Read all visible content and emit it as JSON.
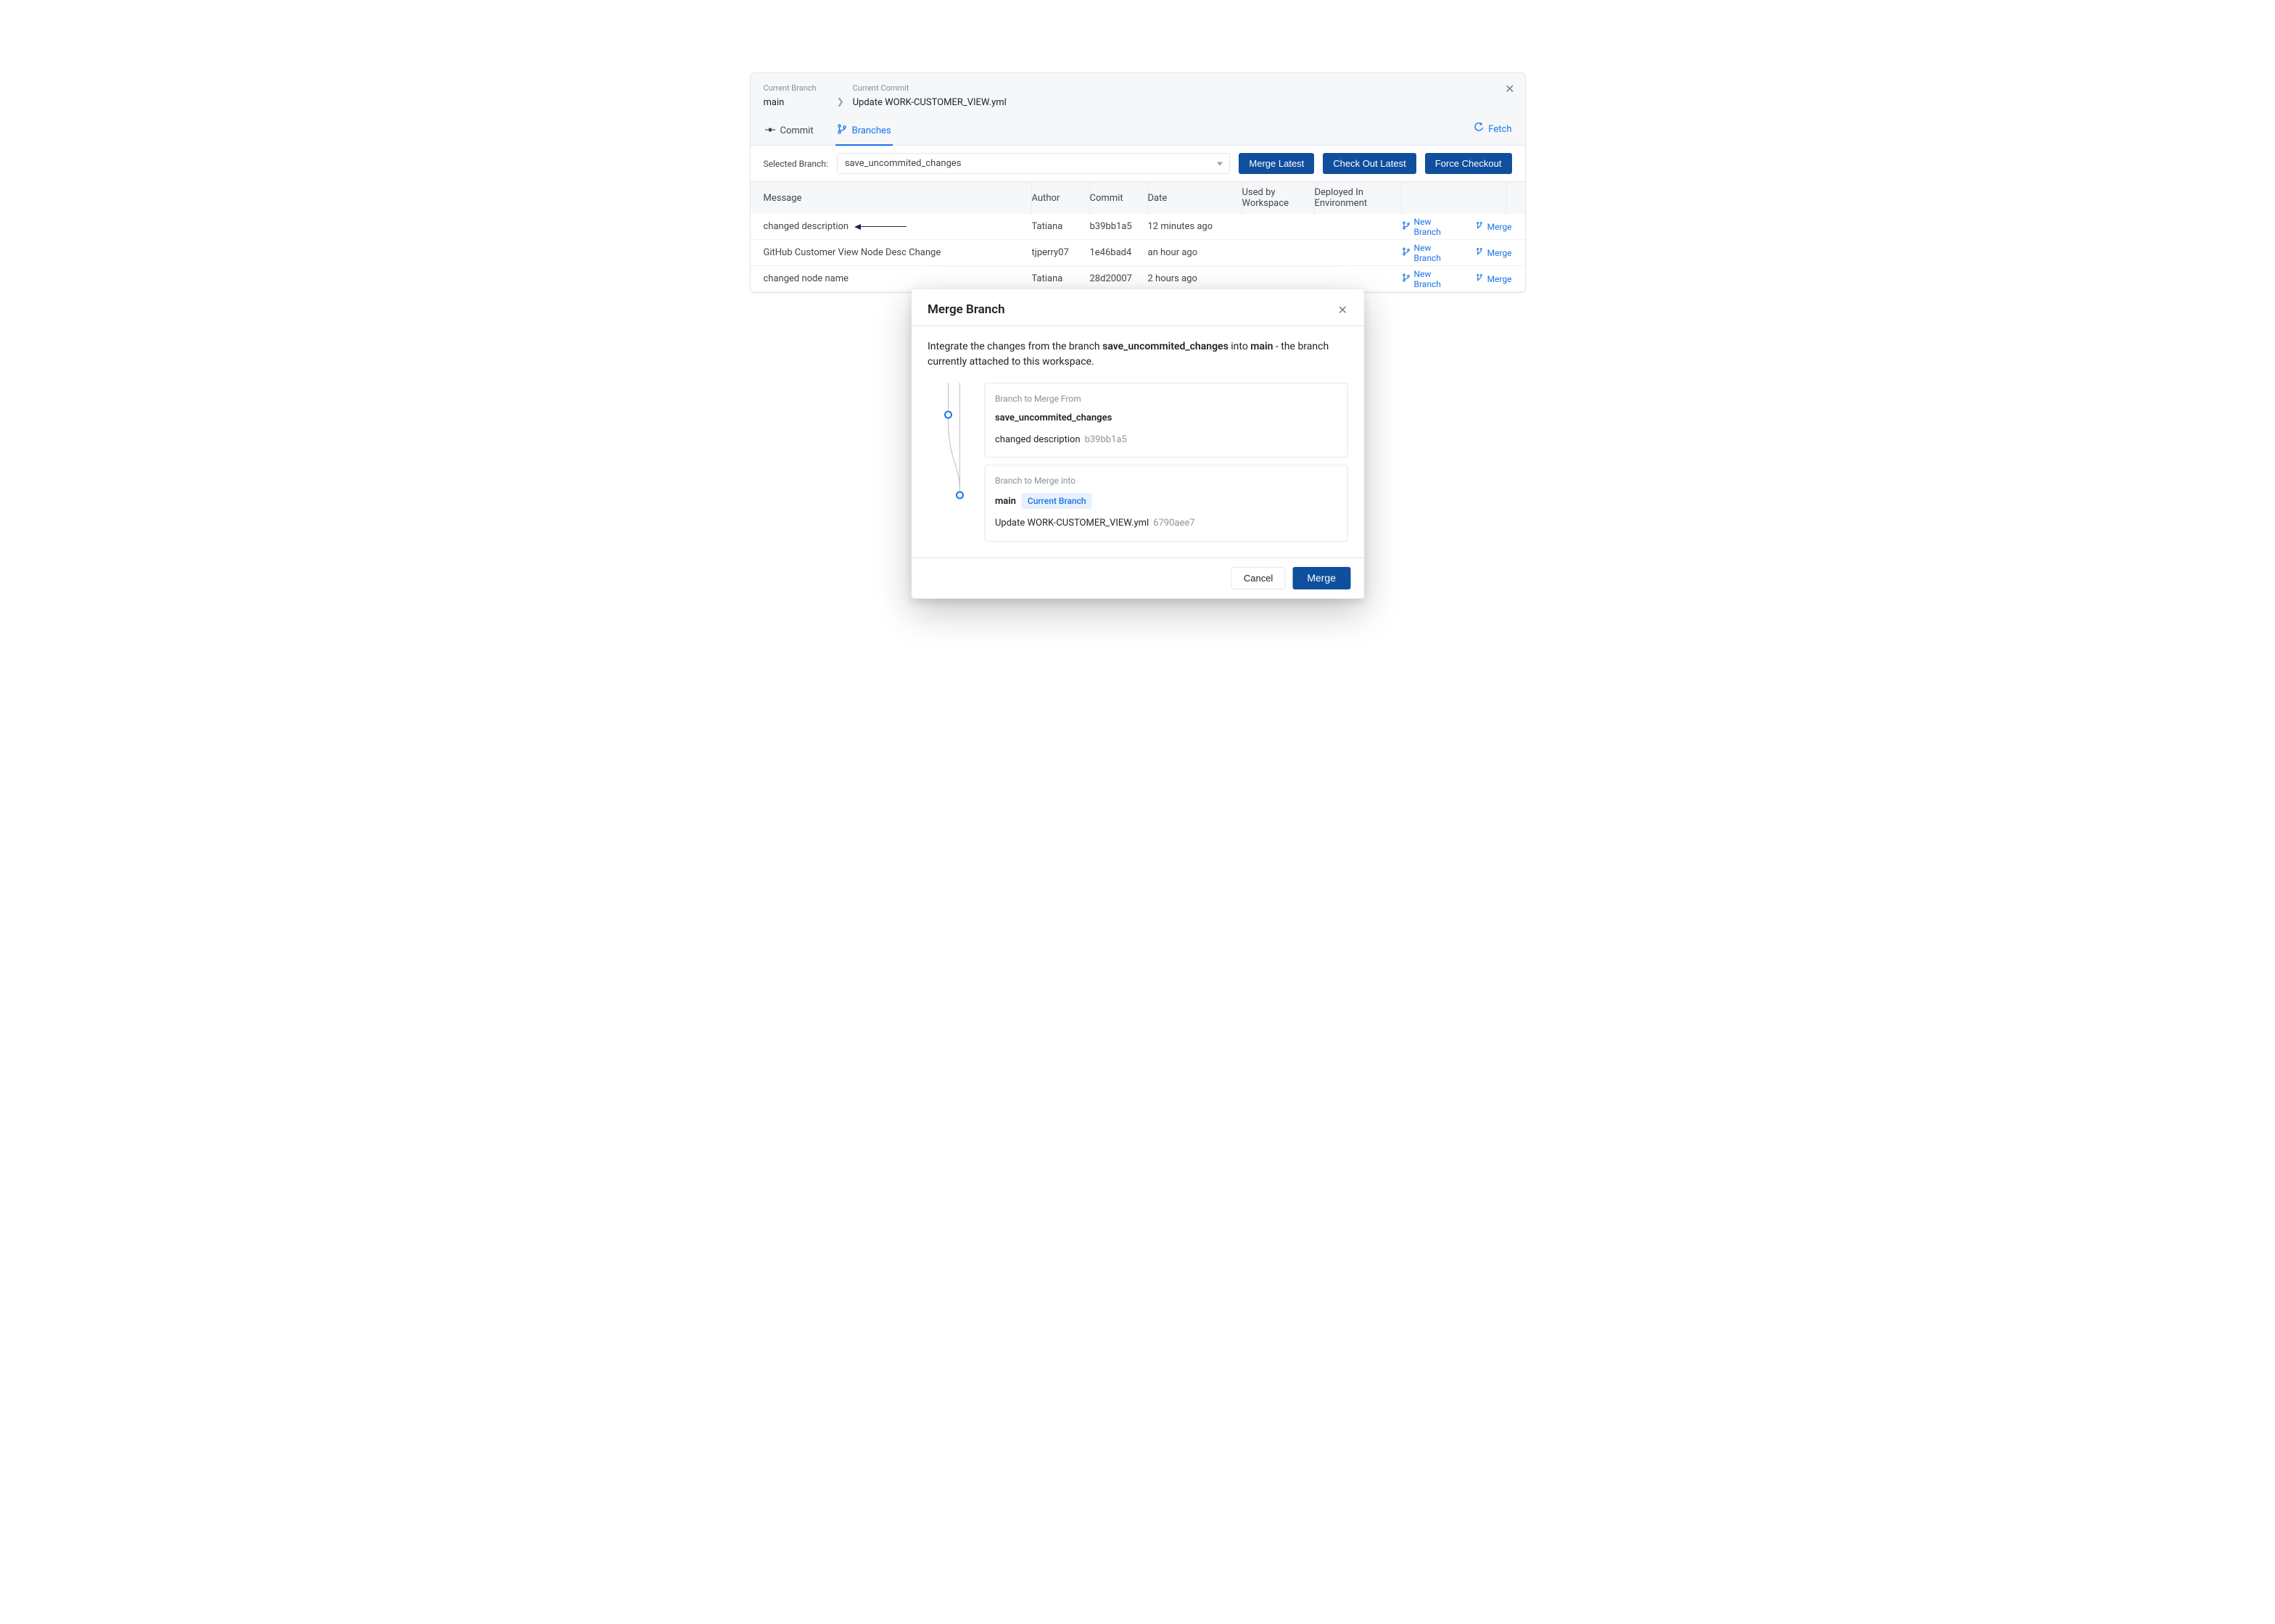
{
  "header": {
    "branch_label": "Current Branch",
    "branch_value": "main",
    "commit_label": "Current Commit",
    "commit_value": "Update WORK-CUSTOMER_VIEW.yml"
  },
  "tabs": {
    "commit": "Commit",
    "branches": "Branches",
    "fetch": "Fetch"
  },
  "selectrow": {
    "label": "Selected Branch:",
    "value": "save_uncommited_changes",
    "merge_latest": "Merge Latest",
    "checkout_latest": "Check Out Latest",
    "force_checkout": "Force Checkout"
  },
  "table": {
    "head": {
      "message": "Message",
      "author": "Author",
      "commit": "Commit",
      "date": "Date",
      "used_by": "Used by Workspace",
      "deployed": "Deployed In Environment"
    },
    "rows": [
      {
        "message": "changed description",
        "author": "Tatiana",
        "commit": "b39bb1a5",
        "date": "12 minutes ago"
      },
      {
        "message": "GitHub Customer View Node Desc Change",
        "author": "tjperry07",
        "commit": "1e46bad4",
        "date": "an hour ago"
      },
      {
        "message": "changed node name",
        "author": "Tatiana",
        "commit": "28d20007",
        "date": "2 hours ago"
      }
    ],
    "actions": {
      "new_branch": "New Branch",
      "merge": "Merge"
    }
  },
  "modal": {
    "title": "Merge Branch",
    "intro_pre": "Integrate the changes from the branch ",
    "intro_from": "save_uncommited_changes",
    "intro_mid": " into ",
    "intro_into": "main",
    "intro_post": " - the branch currently attached to this workspace.",
    "from_label": "Branch to Merge From",
    "from_branch": "save_uncommited_changes",
    "from_commit_msg": "changed description",
    "from_commit_hash": "b39bb1a5",
    "into_label": "Branch to Merge into",
    "into_branch": "main",
    "into_tag": "Current Branch",
    "into_commit_msg": "Update WORK-CUSTOMER_VIEW.yml",
    "into_commit_hash": "6790aee7",
    "cancel": "Cancel",
    "merge": "Merge"
  }
}
